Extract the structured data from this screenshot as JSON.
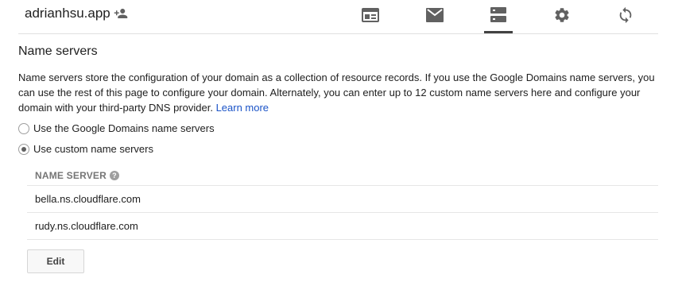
{
  "header": {
    "domain": "adrianhsu.app",
    "add_user_icon": "person-add-icon",
    "nav_icons": [
      "website-icon",
      "email-icon",
      "dns-icon",
      "settings-icon",
      "sync-icon"
    ],
    "active_nav": "dns-icon"
  },
  "section": {
    "title": "Name servers",
    "description": "Name servers store the configuration of your domain as a collection of resource records. If you use the Google Domains name servers, you can use the rest of this page to configure your domain. Alternately, you can enter up to 12 custom name servers here and configure your domain with your third-party DNS provider.",
    "learn_more": "Learn more"
  },
  "options": {
    "google": "Use the Google Domains name servers",
    "custom": "Use custom name servers",
    "selected": "custom"
  },
  "table": {
    "header": "NAME SERVER",
    "help_icon": "?",
    "rows": [
      "bella.ns.cloudflare.com",
      "rudy.ns.cloudflare.com"
    ]
  },
  "actions": {
    "edit_label": "Edit"
  },
  "colors": {
    "link": "#1a53c7",
    "icon": "#616161",
    "active_tab_bar": "#424242"
  }
}
